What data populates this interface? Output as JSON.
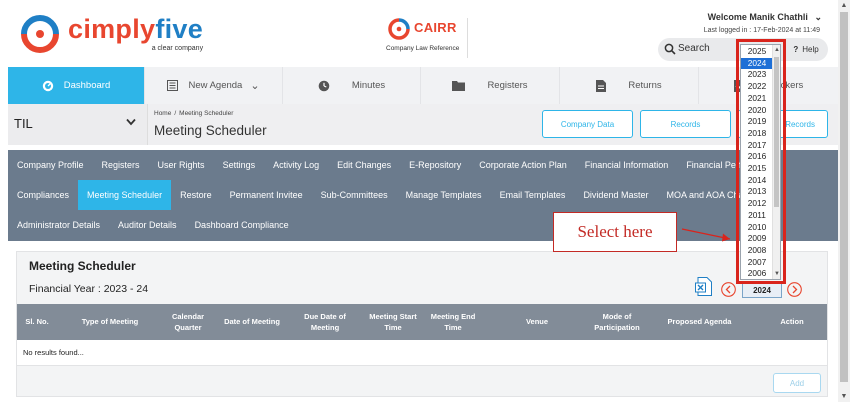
{
  "header": {
    "brand": "cimplyfive",
    "brand_tagline": "a clear company",
    "cairr_title": "CAIRR",
    "cairr_subtitle": "Company Law Reference",
    "welcome": "Welcome Manik  Chathli",
    "last_login": "Last logged in : 17-Feb-2024 at 11:49",
    "search_label": "Search",
    "help_label": "Help"
  },
  "main_nav": [
    {
      "label": "Dashboard",
      "icon": "dashboard-icon",
      "active": true
    },
    {
      "label": "New Agenda",
      "icon": "agenda-icon",
      "active": false
    },
    {
      "label": "Minutes",
      "icon": "clock-icon",
      "active": false
    },
    {
      "label": "Registers",
      "icon": "folder-icon",
      "active": false
    },
    {
      "label": "Returns",
      "icon": "document-icon",
      "active": false
    },
    {
      "label": "Trackers",
      "icon": "tracker-icon",
      "active": false
    }
  ],
  "titlebar": {
    "company": "TIL",
    "breadcrumb": [
      "Home",
      "Meeting Scheduler"
    ],
    "page_title": "Meeting Scheduler",
    "buttons": [
      "Company Data",
      "Records",
      "Records"
    ]
  },
  "sub_nav": {
    "row1": [
      "Company Profile",
      "Registers",
      "User Rights",
      "Settings",
      "Activity Log",
      "Edit Changes",
      "E-Repository",
      "Corporate Action Plan",
      "Financial Information",
      "Financial Performance"
    ],
    "row2": [
      "Compliances",
      "Meeting Scheduler",
      "Restore",
      "Permanent Invitee",
      "Sub-Committees",
      "Manage Templates",
      "Email Templates",
      "Dividend Master",
      "MOA and AOA Changes"
    ],
    "row3": [
      "Administrator Details",
      "Auditor Details",
      "Dashboard Compliance"
    ],
    "active": "Meeting Scheduler"
  },
  "panel": {
    "title": "Meeting Scheduler",
    "financial_year": "Financial Year : 2023 - 24",
    "selected_year": "2024",
    "columns": [
      "Sl. No.",
      "Type of Meeting",
      "Calendar Quarter",
      "Date of Meeting",
      "Due Date of Meeting",
      "Meeting Start Time",
      "Meeting End Time",
      "Venue",
      "Mode of Participation",
      "Proposed Agenda",
      "Action"
    ],
    "empty_message": "No results found...",
    "add_label": "Add"
  },
  "year_dropdown": {
    "options": [
      "2025",
      "2024",
      "2023",
      "2022",
      "2021",
      "2020",
      "2019",
      "2018",
      "2017",
      "2016",
      "2015",
      "2014",
      "2013",
      "2012",
      "2011",
      "2010",
      "2009",
      "2008",
      "2007",
      "2006"
    ],
    "selected": "2024"
  },
  "callout": "Select here",
  "colors": {
    "accent": "#2eb5e8",
    "brand_red": "#e8462f",
    "brand_blue": "#1f7fc5",
    "subnav_bg": "#6b7b8d",
    "annotation_red": "#d9241c"
  }
}
